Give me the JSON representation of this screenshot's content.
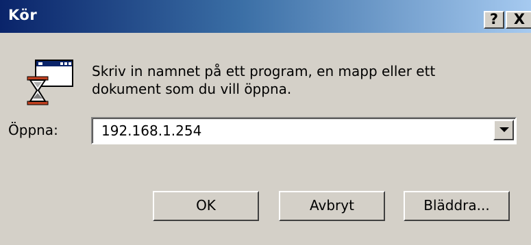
{
  "window": {
    "title": "Kör",
    "help_label": "?",
    "close_label": "X"
  },
  "description": {
    "line1": "Skriv in namnet på ett program, en mapp eller ett",
    "line2": "dokument som du vill öppna."
  },
  "open_field": {
    "label": "Öppna:",
    "value": "192.168.1.254"
  },
  "buttons": {
    "ok": "OK",
    "cancel": "Avbryt",
    "browse": "Bläddra..."
  },
  "icons": {
    "run": "run-program-icon",
    "dropdown": "chevron-down-icon"
  },
  "colors": {
    "titlebar_start": "#0a246a",
    "titlebar_end": "#a6caf0",
    "dialog_face": "#d4d0c8"
  }
}
